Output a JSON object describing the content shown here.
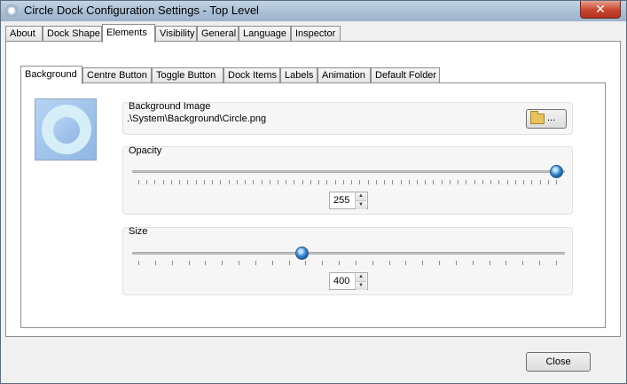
{
  "window": {
    "title": "Circle Dock Configuration Settings - Top Level",
    "close_glyph": "✕"
  },
  "main_tabs": [
    "About",
    "Dock Shape",
    "Elements",
    "Visibility",
    "General",
    "Language",
    "Inspector"
  ],
  "active_main_tab": "Elements",
  "sub_tabs": [
    "Background",
    "Centre Button",
    "Toggle Button",
    "Dock Items",
    "Labels",
    "Animation",
    "Default Folder"
  ],
  "active_sub_tab": "Background",
  "background_image": {
    "label": "Background Image",
    "path": ".\\System\\Background\\Circle.png",
    "browse_label": "...",
    "browse_icon": "folder-open-icon"
  },
  "opacity": {
    "label": "Opacity",
    "value": "255",
    "level": 1.0
  },
  "size": {
    "label": "Size",
    "value": "400",
    "level": 0.39
  },
  "spin_arrows": {
    "up": "▲",
    "down": "▼"
  },
  "footer": {
    "close_label": "Close"
  },
  "colors": {
    "title_bar": "#a7bdd3",
    "close_button": "#c7452f",
    "slider_thumb": "#3f8fd5"
  }
}
